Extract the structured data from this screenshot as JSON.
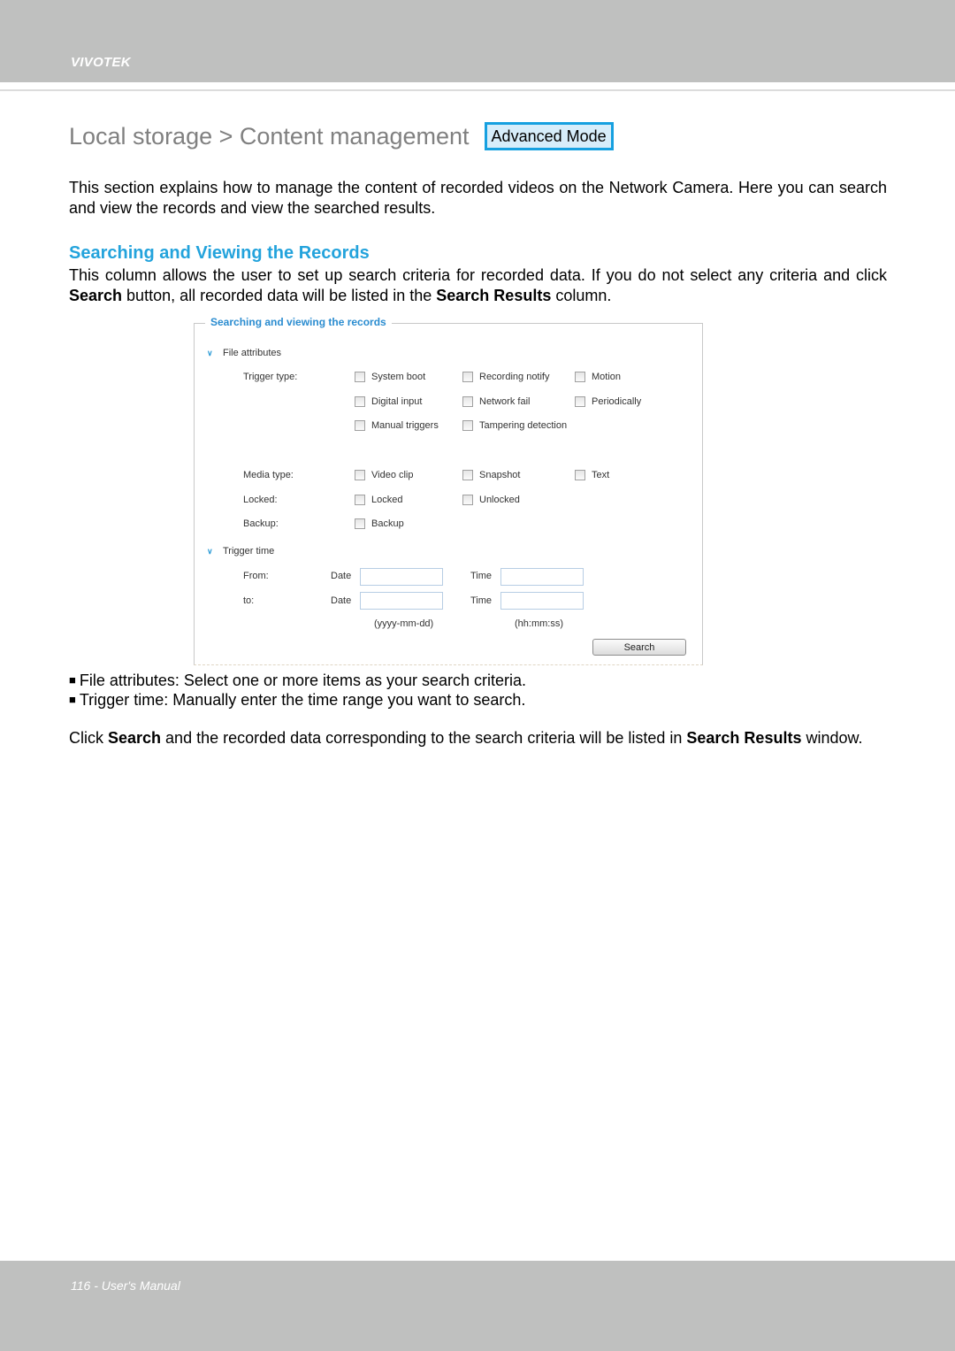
{
  "header": {
    "brand": "VIVOTEK"
  },
  "page": {
    "title": "Local storage > Content management",
    "mode_badge": "Advanced Mode",
    "intro": "This section explains how to manage the content of recorded videos on the Network Camera. Here you can search and view the records and view the searched results.",
    "section_heading": "Searching and Viewing the Records",
    "section_para": {
      "p1": "This column allows the user to set up search criteria for recorded data. If you do not select any criteria and click ",
      "b1": "Search",
      "p2": " button, all recorded data will be listed in the ",
      "b2": "Search Results",
      "p3": " column."
    },
    "bullets": [
      "File attributes: Select one or more items as your search criteria.",
      "Trigger time: Manually enter the time range you want to search."
    ],
    "closing": {
      "p1": "Click ",
      "b1": "Search",
      "p2": " and the recorded data corresponding to the search criteria will be listed in ",
      "b2": "Search Results",
      "p3": " window."
    }
  },
  "panel": {
    "legend": "Searching and viewing the records",
    "file_attributes": {
      "title": "File attributes",
      "trigger_type_label": "Trigger type:",
      "trigger_types": [
        {
          "label": "System boot",
          "checked": false
        },
        {
          "label": "Recording notify",
          "checked": false
        },
        {
          "label": "Motion",
          "checked": false
        },
        {
          "label": "Digital input",
          "checked": false
        },
        {
          "label": "Network fail",
          "checked": false
        },
        {
          "label": "Periodically",
          "checked": false
        },
        {
          "label": "Manual triggers",
          "checked": false
        },
        {
          "label": "Tampering detection",
          "checked": false
        }
      ],
      "media_type_label": "Media type:",
      "media_types": [
        {
          "label": "Video clip",
          "checked": false
        },
        {
          "label": "Snapshot",
          "checked": false
        },
        {
          "label": "Text",
          "checked": false
        }
      ],
      "locked_label": "Locked:",
      "locked_options": [
        {
          "label": "Locked",
          "checked": false
        },
        {
          "label": "Unlocked",
          "checked": false
        }
      ],
      "backup_label": "Backup:",
      "backup_options": [
        {
          "label": "Backup",
          "checked": false
        }
      ]
    },
    "trigger_time": {
      "title": "Trigger time",
      "from_label": "From:",
      "to_label": "to:",
      "date_label": "Date",
      "time_label": "Time",
      "from_date": "",
      "from_time": "",
      "to_date": "",
      "to_time": "",
      "date_hint": "(yyyy-mm-dd)",
      "time_hint": "(hh:mm:ss)"
    },
    "search_button": "Search"
  },
  "footer": {
    "text": "116 - User's Manual"
  },
  "colors": {
    "band_gray": "#bfc0bf",
    "heading_blue": "#23a3dc",
    "badge_border": "#16a0e0",
    "badge_fill": "#d7edfa",
    "title_gray": "#808080"
  }
}
